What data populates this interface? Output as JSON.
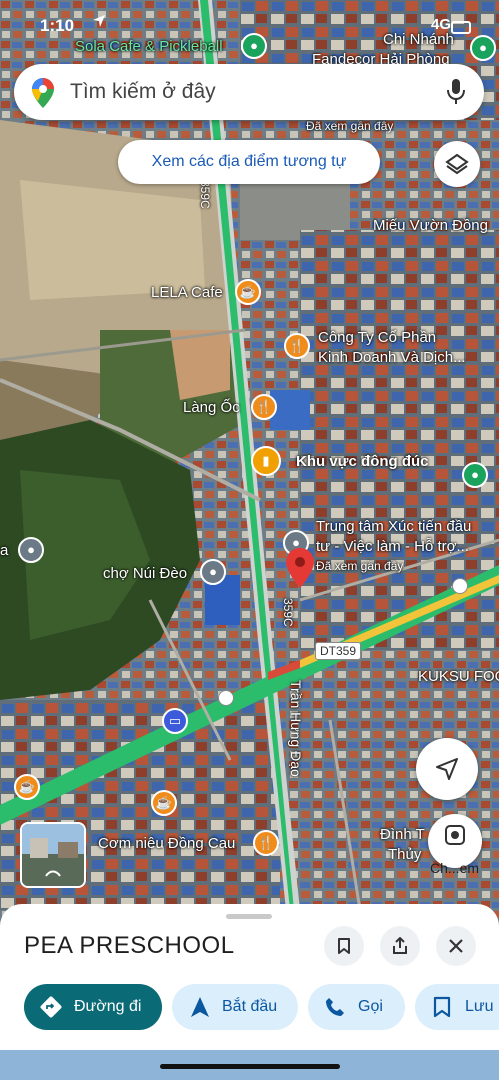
{
  "status_bar": {
    "time": "1:10",
    "signal": "4G"
  },
  "search": {
    "placeholder": "Tìm kiếm ở đây"
  },
  "similar_places_chip": "Xem các địa điểm tương tự",
  "map_labels": {
    "sola_cafe": "Sola Cafe & Pickleball",
    "chi_nhanh": "Chi Nhánh",
    "fandecor": "Fandecor Hải Phòng",
    "da_xem_top": "Đã xem gần đây",
    "mieu": "Miếu Vườn Đồng",
    "lela": "LELA Cafe",
    "cong_ty_1": "Công Ty Cổ Phần",
    "cong_ty_2": "Kinh Doanh Và Dịch...",
    "lang_oc": "Làng Ốc",
    "khu_vuc": "Khu vực đông đúc",
    "trung_tam_1": "Trung tâm Xúc tiến đầu",
    "trung_tam_2": "tư - Việc làm - Hỗ trợ...",
    "da_xem_mid": "Đã xem gần đây",
    "cho_nui_deo": "chợ Núi Đèo",
    "left_a": "a",
    "road_359c_top": "359C",
    "road_359c_mid": "359C",
    "dt359": "DT359",
    "kuksu": "KUKSU FOO",
    "tran_hung_dao": "Trần Hưng Đạo",
    "com_nieu": "Cơm niêu Đồng Cau",
    "dinh_1": "Đình T",
    "dinh_2": "Thủy"
  },
  "lens_label": "Ch...em",
  "place_sheet": {
    "title": "PEA PRESCHOOL",
    "actions": [
      {
        "label": "Đường đi",
        "icon": "directions-icon"
      },
      {
        "label": "Bắt đầu",
        "icon": "navigation-arrow-icon"
      },
      {
        "label": "Gọi",
        "icon": "phone-icon"
      },
      {
        "label": "Lưu",
        "icon": "bookmark-icon"
      }
    ]
  },
  "colors": {
    "accent": "#0a6a76",
    "chip_text": "#1a5bb6",
    "pin_red": "#e53935",
    "road_green": "#2bbd6b"
  }
}
